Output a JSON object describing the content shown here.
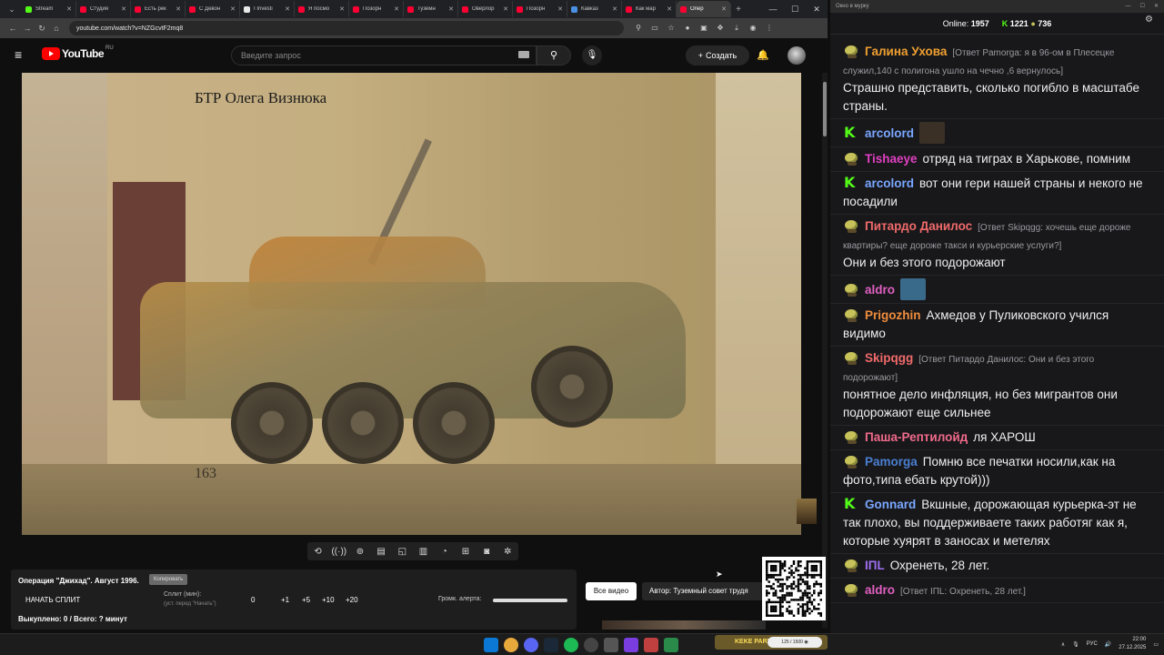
{
  "browser": {
    "tabs": [
      {
        "label": "Stream",
        "color": "#53fc18"
      },
      {
        "label": "Студия",
        "color": "#ff0033"
      },
      {
        "label": "Есть рек",
        "color": "#ff0033"
      },
      {
        "label": "С Девон",
        "color": "#ff0033"
      },
      {
        "label": "I Investi",
        "color": "#e8e8e8"
      },
      {
        "label": "Я посмо",
        "color": "#ff0033"
      },
      {
        "label": "Позорн",
        "color": "#ff0033"
      },
      {
        "label": "Туземн",
        "color": "#ff0033"
      },
      {
        "label": "Оверлор",
        "color": "#ff0033"
      },
      {
        "label": "Позорн",
        "color": "#ff0033"
      },
      {
        "label": "Кавказ",
        "color": "#4a90e2"
      },
      {
        "label": "Как мар",
        "color": "#ff0033"
      },
      {
        "label": "Опер",
        "color": "#ff0033",
        "active": true
      }
    ],
    "new_tab": "+",
    "url": "youtube.com/watch?v=NZGcvtF2mq8",
    "win_controls": [
      "—",
      "☐",
      "✕"
    ]
  },
  "youtube": {
    "logo_text": "YouTube",
    "region": "RU",
    "search_placeholder": "Введите запрос",
    "create_label": "Создать"
  },
  "video": {
    "overlay_title": "БТР Олега Визнюка",
    "vehicle_number": "163"
  },
  "tools": {
    "icons": [
      "repeat-icon",
      "broadcast-icon",
      "record-icon",
      "clapper-icon",
      "pip-icon",
      "frames-icon",
      "speed-icon",
      "add-icon",
      "camera-icon",
      "gear-icon"
    ]
  },
  "split_panel": {
    "operation_title": "Операция \"Джихад\". Август 1996.",
    "copy_label": "Копировать",
    "start_split": "НАЧАТЬ СПЛИТ",
    "split_label": "Сплит (мин):",
    "split_hint": "(уст. перед \"Начать\")",
    "values": [
      "0",
      "+1",
      "+5",
      "+10",
      "+20"
    ],
    "alert_label": "Громк. алерта:",
    "alert_volume": 1.0,
    "bought": "Выкуплено: 0 / Всего: ? минут"
  },
  "buttons": {
    "all_videos": "Все видео",
    "author": "Автор: Туземный совет трудя"
  },
  "chat": {
    "window_title": "Окно в мурку",
    "online_label": "Online:",
    "online_count": "1957",
    "kick_count": "1221",
    "pepe_count": "736",
    "messages": [
      {
        "badge": "pepe",
        "user": "Галина Ухова",
        "color": "#f0a030",
        "reply": "[Ответ Pamorga: я в 96-ом в Плесецке служил,140 с полигона ушло на чечно ,6 вернулось]",
        "text": "Страшно представить, сколько погибло в масштабе страны."
      },
      {
        "badge": "kick",
        "user": "arcolord",
        "color": "#7aa7ff",
        "reply": "",
        "text": "",
        "emote": "#3a3026"
      },
      {
        "badge": "pepe",
        "user": "Tishaeye",
        "color": "#e040c0",
        "reply": "",
        "text": "отряд на тиграх в Харькове, помним"
      },
      {
        "badge": "kick",
        "user": "arcolord",
        "color": "#7aa7ff",
        "reply": "",
        "text": "вот они гери нашей страны и некого не посадили"
      },
      {
        "badge": "pepe",
        "user": "Питардо Данилос",
        "color": "#f06a6a",
        "reply": "[Ответ Skipqgg: хочешь еще дороже квартиры? еще дороже такси и курьерские услуги?]",
        "text": "Они и без этого подорожают"
      },
      {
        "badge": "pepe",
        "user": "aldro",
        "color": "#e060c0",
        "reply": "",
        "text": "",
        "emote": "#3a6a8a"
      },
      {
        "badge": "pepe",
        "user": "Prigozhin",
        "color": "#f08c3a",
        "reply": "",
        "text": "Ахмедов у Пуликовского учился видимо"
      },
      {
        "badge": "pepe",
        "user": "Skipqgg",
        "color": "#f06a6a",
        "reply": "[Ответ Питардо Данилос: Они и без этого подорожают]",
        "text": "понятное дело инфляция, но без мигрантов они подорожают еще сильнее"
      },
      {
        "badge": "pepe",
        "user": "Паша-Рептилойд",
        "color": "#f06a8a",
        "reply": "",
        "text": "ля ХАРОШ"
      },
      {
        "badge": "pepe",
        "user": "Pamorga",
        "color": "#4a7fd0",
        "reply": "",
        "text": "Помню все печатки носили,как на фото,типа ебать крутой)))"
      },
      {
        "badge": "kick",
        "user": "Gonnard",
        "color": "#7aa7ff",
        "reply": "",
        "text": "Вкшные, дорожающая курьерка-эт не так плохо, вы поддерживаете таких работяг как я, которые хуярят в заносах и метелях"
      },
      {
        "badge": "pepe",
        "user": "IПL",
        "color": "#a070f0",
        "reply": "",
        "text": "Охренеть, 28 лет."
      },
      {
        "badge": "pepe",
        "user": "aldro",
        "color": "#e060c0",
        "reply": "[Ответ IПL: Охренеть, 28 лет.]",
        "text": ""
      }
    ]
  },
  "taskbar": {
    "overlay_label": "KEKE PARTY",
    "overlay_count": "125 / 1500 ◉",
    "lang": "РУС",
    "time": "22:00",
    "date": "27.12.2025"
  }
}
